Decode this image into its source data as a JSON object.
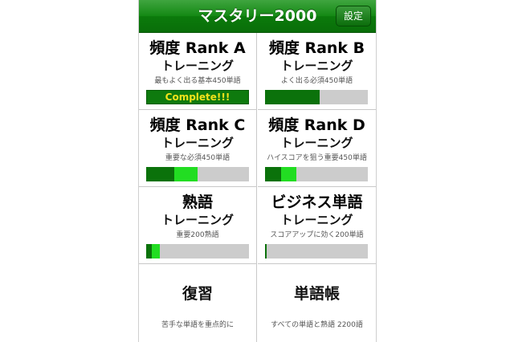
{
  "header": {
    "title": "マスタリー2000",
    "settings_label": "設定"
  },
  "menu": [
    {
      "title": "頻度 Rank A",
      "subtitle": "トレーニング",
      "caption": "最もよく出る基本450単語",
      "complete_label": "Complete!!!",
      "progress": 1.0
    },
    {
      "title": "頻度 Rank B",
      "subtitle": "トレーニング",
      "caption": "よく出る必須450単語",
      "progress": 0.53
    },
    {
      "title": "頻度 Rank C",
      "subtitle": "トレーニング",
      "caption": "重要な必須450単語",
      "progress": 0.5
    },
    {
      "title": "頻度 Rank D",
      "subtitle": "トレーニング",
      "caption": "ハイスコアを狙う重要450単語",
      "progress": 0.3
    },
    {
      "title": "熟語",
      "subtitle": "トレーニング",
      "caption": "重要200熟語",
      "progress": 0.13
    },
    {
      "title": "ビジネス単語",
      "subtitle": "トレーニング",
      "caption": "スコアアップに効く200単語",
      "progress": 0.01
    },
    {
      "title": "復習",
      "caption": "苦手な単語を重点的に"
    },
    {
      "title": "単語帳",
      "caption": "すべての単語と熟語 2200語"
    }
  ],
  "colors": {
    "accent": "#0b7a0b",
    "dark_green": "#0b720b",
    "bright_green": "#22dd22",
    "track": "#cccccc",
    "complete_text": "#f2e21b"
  }
}
